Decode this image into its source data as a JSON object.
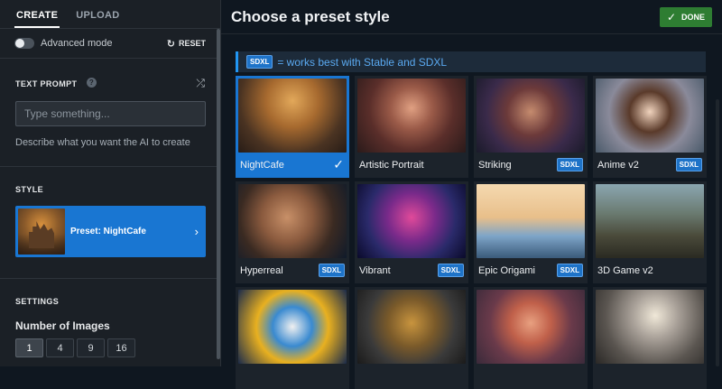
{
  "left": {
    "tabs": [
      {
        "label": "CREATE",
        "active": true
      },
      {
        "label": "UPLOAD",
        "active": false
      }
    ],
    "advanced_mode": {
      "label": "Advanced mode",
      "enabled": false
    },
    "reset_label": "RESET",
    "text_prompt": {
      "title": "TEXT PROMPT",
      "help": "?",
      "placeholder": "Type something...",
      "value": "",
      "hint": "Describe what you want the AI to create"
    },
    "style": {
      "title": "STYLE",
      "preset_label": "Preset: NightCafe"
    },
    "settings": {
      "title": "SETTINGS",
      "num_images_label": "Number of Images",
      "options": [
        "1",
        "4",
        "9",
        "16"
      ],
      "selected": "1"
    }
  },
  "right": {
    "title": "Choose a preset style",
    "done_label": "DONE",
    "banner": {
      "badge": "SDXL",
      "text": "= works best with Stable and SDXL"
    },
    "styles": [
      {
        "label": "NightCafe",
        "sdxl": false,
        "selected": true
      },
      {
        "label": "Artistic Portrait",
        "sdxl": false,
        "selected": false
      },
      {
        "label": "Striking",
        "sdxl": true,
        "selected": false
      },
      {
        "label": "Anime v2",
        "sdxl": true,
        "selected": false
      },
      {
        "label": "Hyperreal",
        "sdxl": true,
        "selected": false
      },
      {
        "label": "Vibrant",
        "sdxl": true,
        "selected": false
      },
      {
        "label": "Epic Origami",
        "sdxl": true,
        "selected": false
      },
      {
        "label": "3D Game v2",
        "sdxl": false,
        "selected": false
      },
      {
        "label": "",
        "sdxl": false,
        "selected": false
      },
      {
        "label": "",
        "sdxl": false,
        "selected": false
      },
      {
        "label": "",
        "sdxl": false,
        "selected": false
      },
      {
        "label": "",
        "sdxl": false,
        "selected": false
      }
    ],
    "sdxl_badge": "SDXL"
  },
  "colors": {
    "accent": "#1976d2",
    "done": "#2e7d32",
    "banner_text": "#5aa9f0",
    "background": "#0f1720",
    "panel": "#1b2026"
  },
  "icons": {
    "reset": "refresh-icon",
    "shuffle": "shuffle-icon",
    "chevron": "chevron-right-icon",
    "done": "check-icon",
    "selected": "check-icon"
  }
}
